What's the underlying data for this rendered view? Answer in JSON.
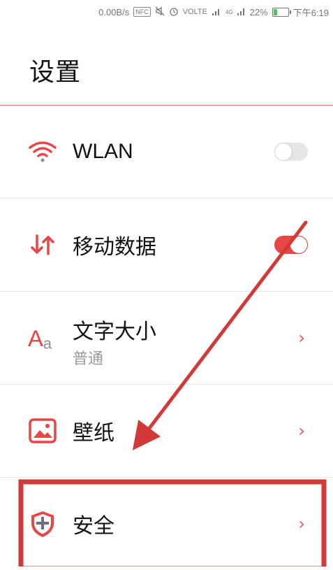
{
  "status_bar": {
    "speed": "0.00B/s",
    "nfc": "NFC",
    "volte": "VOLTE",
    "network": "4G",
    "battery": "22%",
    "battery_level": 0.22,
    "time": "下午6:19"
  },
  "page": {
    "title": "设置"
  },
  "settings": [
    {
      "label": "WLAN",
      "icon": "wifi-icon",
      "control": "toggle",
      "enabled": false
    },
    {
      "label": "移动数据",
      "icon": "mobile-data-icon",
      "control": "toggle",
      "enabled": true
    },
    {
      "label": "文字大小",
      "sublabel": "普通",
      "icon": "font-size-icon",
      "control": "chevron"
    },
    {
      "label": "壁纸",
      "icon": "wallpaper-icon",
      "control": "chevron"
    },
    {
      "label": "安全",
      "icon": "security-shield-icon",
      "control": "chevron"
    }
  ],
  "colors": {
    "accent": "#e84545",
    "annotation": "#d23a3a",
    "battery_fill": "#4cc25a"
  }
}
